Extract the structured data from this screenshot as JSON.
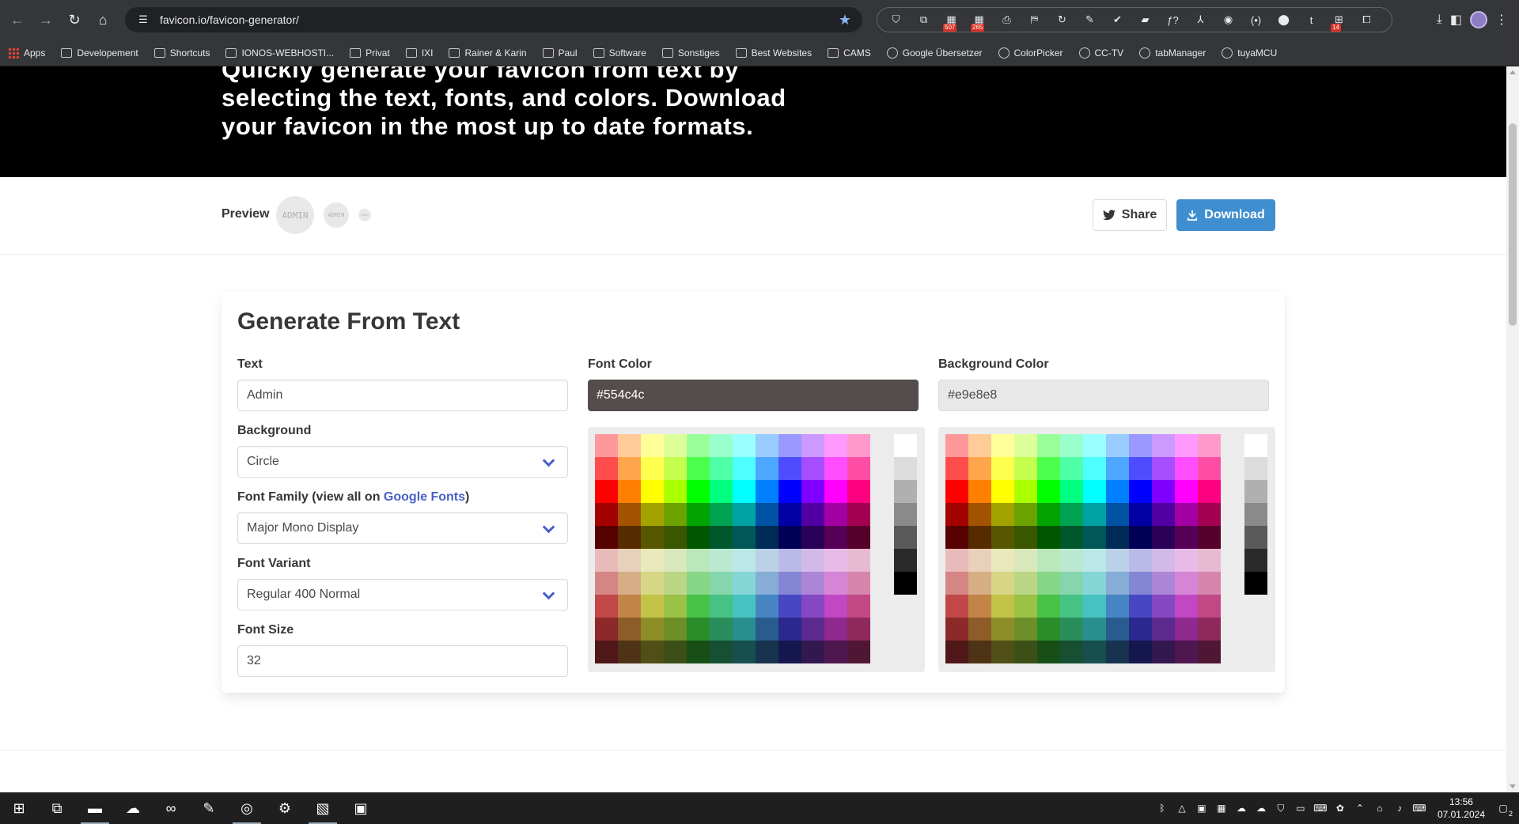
{
  "browser": {
    "url": "favicon.io/favicon-generator/",
    "extensions": [
      {
        "icon": "shield-icon",
        "glyph": "⛉",
        "badge": ""
      },
      {
        "icon": "terminal-icon",
        "glyph": "⧉",
        "badge": ""
      },
      {
        "icon": "calendar-icon",
        "glyph": "▦",
        "badge": "507"
      },
      {
        "icon": "calendar-icon",
        "glyph": "▦",
        "badge": "265"
      },
      {
        "icon": "print-icon",
        "glyph": "⎙",
        "badge": ""
      },
      {
        "icon": "bookmark-icon",
        "glyph": "⛿",
        "badge": ""
      },
      {
        "icon": "refresh-icon",
        "glyph": "↻",
        "badge": ""
      },
      {
        "icon": "eyedropper-icon",
        "glyph": "✎",
        "badge": ""
      },
      {
        "icon": "check-icon",
        "glyph": "✔",
        "badge": ""
      },
      {
        "icon": "tag-icon",
        "glyph": "▰",
        "badge": ""
      },
      {
        "icon": "function-icon",
        "glyph": "ƒ?",
        "badge": ""
      },
      {
        "icon": "pdf-icon",
        "glyph": "⅄",
        "badge": ""
      },
      {
        "icon": "cookie-icon",
        "glyph": "◉",
        "badge": ""
      },
      {
        "icon": "code-icon",
        "glyph": "(•)",
        "badge": ""
      },
      {
        "icon": "record-icon",
        "glyph": "⬤",
        "badge": ""
      },
      {
        "icon": "t-icon",
        "glyph": "t",
        "badge": ""
      },
      {
        "icon": "apps-icon",
        "glyph": "⊞",
        "badge": "14"
      },
      {
        "icon": "puzzle-icon",
        "glyph": "⧠",
        "badge": ""
      }
    ],
    "bookmarks": [
      {
        "label": "Apps",
        "icon": "grid"
      },
      {
        "label": "Developement",
        "icon": "folder"
      },
      {
        "label": "Shortcuts",
        "icon": "folder"
      },
      {
        "label": "IONOS-WEBHOSTI...",
        "icon": "folder"
      },
      {
        "label": "Privat",
        "icon": "folder"
      },
      {
        "label": "IXI",
        "icon": "folder"
      },
      {
        "label": "Rainer & Karin",
        "icon": "folder"
      },
      {
        "label": "Paul",
        "icon": "folder"
      },
      {
        "label": "Software",
        "icon": "folder"
      },
      {
        "label": "Sonstiges",
        "icon": "folder"
      },
      {
        "label": "Best Websites",
        "icon": "folder"
      },
      {
        "label": "CAMS",
        "icon": "folder"
      },
      {
        "label": "Google Übersetzer",
        "icon": "round"
      },
      {
        "label": "ColorPicker",
        "icon": "round"
      },
      {
        "label": "CC-TV",
        "icon": "round"
      },
      {
        "label": "tabManager",
        "icon": "round"
      },
      {
        "label": "tuyaMCU",
        "icon": "round"
      }
    ]
  },
  "hero": {
    "text": "Quickly generate your favicon from text by selecting the text, fonts, and colors. Download your favicon in the most up to date formats."
  },
  "preview": {
    "label": "Preview",
    "favicon_text": "ADMIN",
    "share_label": "Share",
    "download_label": "Download"
  },
  "form": {
    "title": "Generate From Text",
    "text_label": "Text",
    "text_value": "Admin",
    "background_label": "Background",
    "background_value": "Circle",
    "font_family_label": "Font Family (view all on ",
    "font_family_link": "Google Fonts",
    "font_family_suffix": ")",
    "font_family_value": "Major Mono Display",
    "font_variant_label": "Font Variant",
    "font_variant_value": "Regular 400 Normal",
    "font_size_label": "Font Size",
    "font_size_value": "32",
    "font_color_label": "Font Color",
    "font_color_value": "#554c4c",
    "bg_color_label": "Background Color",
    "bg_color_value": "#e9e8e8"
  },
  "colors": {
    "font_color": "#554c4c",
    "bg_color": "#e9e8e8",
    "accent": "#3e8ed0",
    "link": "#485fc7"
  },
  "taskbar": {
    "apps": [
      {
        "icon": "windows-start-icon",
        "glyph": "⊞",
        "open": false
      },
      {
        "icon": "task-view-icon",
        "glyph": "⧉",
        "open": false
      },
      {
        "icon": "file-explorer-icon",
        "glyph": "▬",
        "open": true
      },
      {
        "icon": "cloud-sync-icon",
        "glyph": "☁",
        "open": false
      },
      {
        "icon": "arduino-icon",
        "glyph": "∞",
        "open": false
      },
      {
        "icon": "notepad-icon",
        "glyph": "✎",
        "open": false
      },
      {
        "icon": "chrome-icon",
        "glyph": "◎",
        "open": true
      },
      {
        "icon": "settings-icon",
        "glyph": "⚙",
        "open": false
      },
      {
        "icon": "paint-icon",
        "glyph": "▧",
        "open": true
      },
      {
        "icon": "image-viewer-icon",
        "glyph": "▣",
        "open": false
      }
    ],
    "time": "13:56",
    "date": "07.01.2024",
    "notifications": "2"
  }
}
